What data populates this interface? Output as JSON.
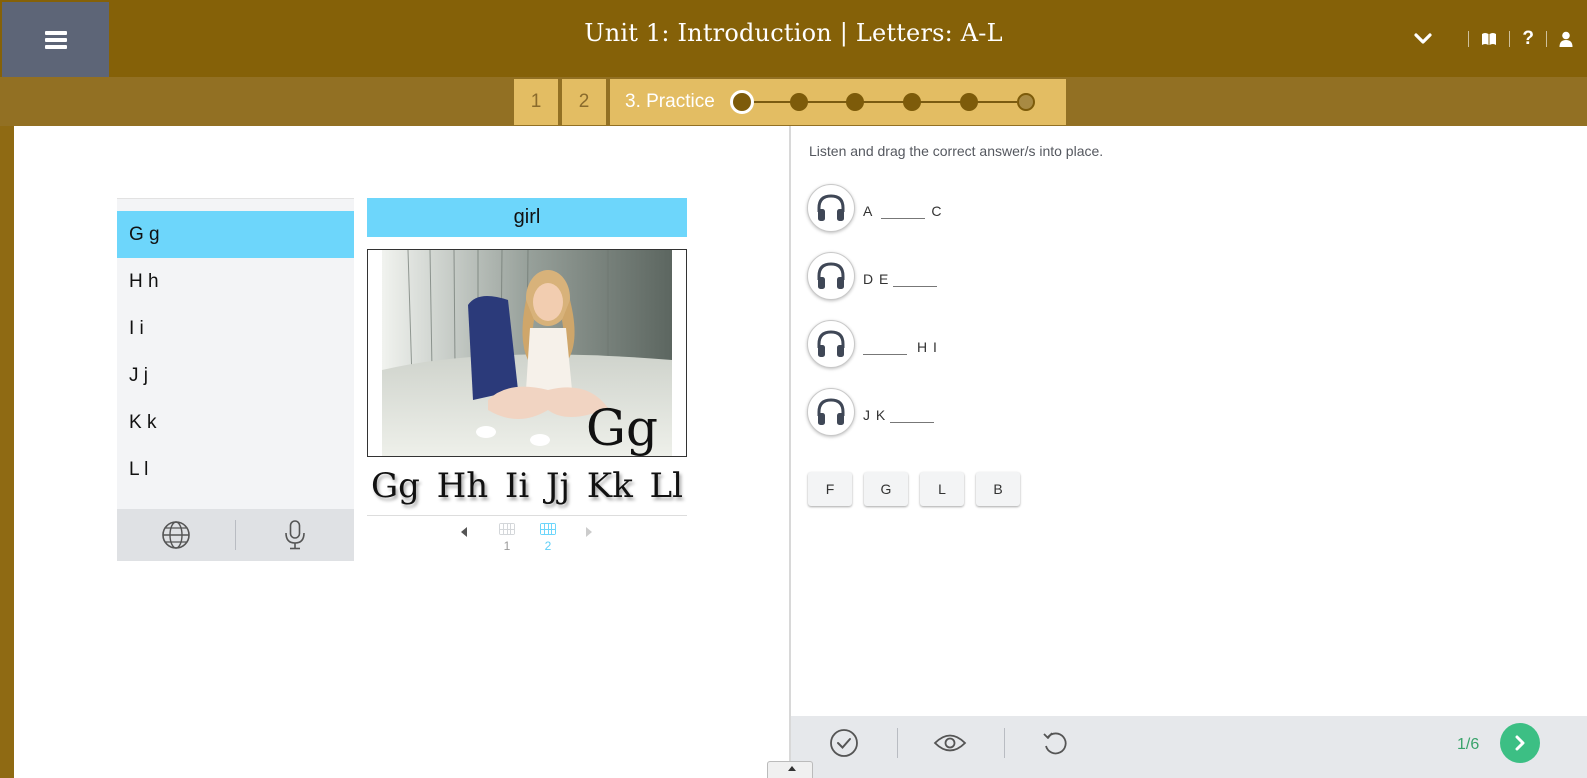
{
  "header": {
    "title": "Unit 1: Introduction  | Letters: A-L",
    "icons": [
      "menu-icon",
      "chevron-down-icon",
      "book-icon",
      "help-icon",
      "user-icon"
    ],
    "help_label": "?"
  },
  "stepbar": {
    "steps": [
      {
        "label": "1"
      },
      {
        "label": "2"
      }
    ],
    "active_label": "3. Practice",
    "dots_total": 6,
    "dots_current": 1
  },
  "letters": {
    "items": [
      {
        "label": "G g",
        "active": true
      },
      {
        "label": "H h",
        "active": false
      },
      {
        "label": "I i",
        "active": false
      },
      {
        "label": "J j",
        "active": false
      },
      {
        "label": "K k",
        "active": false
      },
      {
        "label": "L l",
        "active": false
      }
    ],
    "footer_icons": [
      "globe-icon",
      "microphone-icon"
    ]
  },
  "viewer": {
    "word": "girl",
    "photo_caption": "Gg",
    "strip": [
      "Gg",
      "Hh",
      "Ii",
      "Jj",
      "Kk",
      "Ll"
    ],
    "pages": [
      {
        "label": "1",
        "active": false
      },
      {
        "label": "2",
        "active": true
      }
    ],
    "active_color": "#6dd6fb"
  },
  "exercise": {
    "instruction": "Listen and drag the correct answer/s into place.",
    "questions": [
      {
        "before": "A",
        "after": "C"
      },
      {
        "before": "D E",
        "after": ""
      },
      {
        "before": "",
        "after": "H I"
      },
      {
        "before": "J K",
        "after": ""
      }
    ],
    "answers": [
      "F",
      "G",
      "L",
      "B"
    ],
    "page_count": "1/6",
    "toolbar_icons": [
      "check-icon",
      "eye-icon",
      "reset-icon",
      "next-arrow-icon"
    ]
  },
  "colors": {
    "header": "#856108",
    "stepbar": "#927023",
    "step_tab": "#e3bd63",
    "menu": "#5d6577",
    "highlight": "#6dd6fb",
    "accent_green": "#3cbf84"
  }
}
